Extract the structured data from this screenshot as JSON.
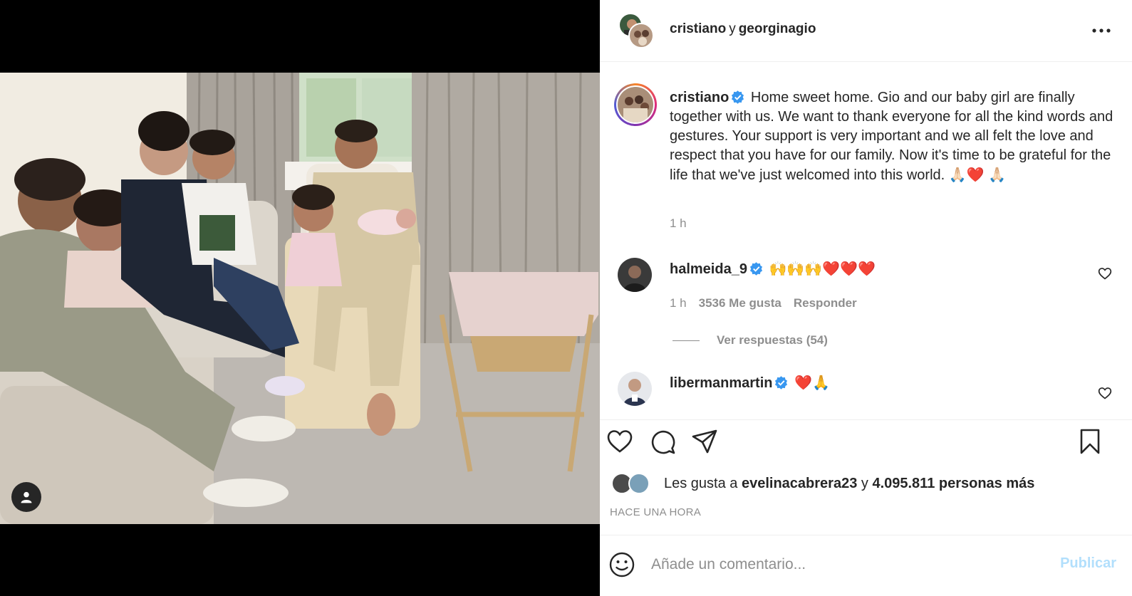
{
  "header": {
    "username_1": "cristiano",
    "conjunction": "y",
    "username_2": "georginagio",
    "more_icon": "more-horizontal-icon"
  },
  "caption": {
    "username": "cristiano",
    "verified_icon": "verified-badge-icon",
    "text": "Home sweet home. Gio and our baby girl are finally together with us. We want to thank everyone for all the kind words and gestures. Your support is very important and we all felt the love and respect that you have for our family. Now it's time to be grateful for the life that we've just welcomed into this world.",
    "emojis": [
      "🙏🏻",
      "❤️",
      "🙏🏻"
    ],
    "time": "1 h"
  },
  "comments": [
    {
      "username": "halmeida_9",
      "verified": true,
      "emojis": [
        "🙌",
        "🙌",
        "🙌",
        "❤️",
        "❤️",
        "❤️"
      ],
      "time": "1 h",
      "likes": "3536 Me gusta",
      "reply_label": "Responder",
      "view_replies": "Ver respuestas (54)"
    },
    {
      "username": "libermanmartin",
      "verified": true,
      "emojis": [
        "❤️",
        "🙏"
      ]
    }
  ],
  "actions": {
    "like_icon": "heart-icon",
    "comment_icon": "comment-icon",
    "share_icon": "paper-plane-icon",
    "save_icon": "bookmark-icon"
  },
  "likes": {
    "prefix": "Les gusta a",
    "user": "evelinacabrera23",
    "conjunction": "y",
    "others": "4.095.811 personas más"
  },
  "timestamp": "HACE UNA HORA",
  "add_comment": {
    "placeholder": "Añade un comentario...",
    "publish_label": "Publicar",
    "emoji_icon": "smiley-icon"
  },
  "media": {
    "user_tag_icon": "user-tag-icon"
  },
  "colors": {
    "link_blue_disabled": "#b2dffc",
    "secondary_text": "#8e8e8e",
    "verified_blue": "#3897f0",
    "heart_red": "#e0102a"
  }
}
